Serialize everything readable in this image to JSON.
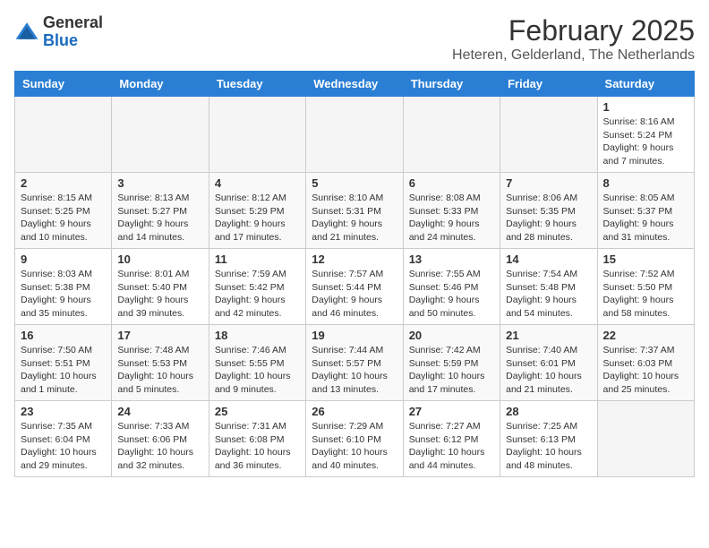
{
  "logo": {
    "text_general": "General",
    "text_blue": "Blue"
  },
  "title": "February 2025",
  "location": "Heteren, Gelderland, The Netherlands",
  "days_of_week": [
    "Sunday",
    "Monday",
    "Tuesday",
    "Wednesday",
    "Thursday",
    "Friday",
    "Saturday"
  ],
  "weeks": [
    [
      {
        "day": "",
        "info": ""
      },
      {
        "day": "",
        "info": ""
      },
      {
        "day": "",
        "info": ""
      },
      {
        "day": "",
        "info": ""
      },
      {
        "day": "",
        "info": ""
      },
      {
        "day": "",
        "info": ""
      },
      {
        "day": "1",
        "info": "Sunrise: 8:16 AM\nSunset: 5:24 PM\nDaylight: 9 hours and 7 minutes."
      }
    ],
    [
      {
        "day": "2",
        "info": "Sunrise: 8:15 AM\nSunset: 5:25 PM\nDaylight: 9 hours and 10 minutes."
      },
      {
        "day": "3",
        "info": "Sunrise: 8:13 AM\nSunset: 5:27 PM\nDaylight: 9 hours and 14 minutes."
      },
      {
        "day": "4",
        "info": "Sunrise: 8:12 AM\nSunset: 5:29 PM\nDaylight: 9 hours and 17 minutes."
      },
      {
        "day": "5",
        "info": "Sunrise: 8:10 AM\nSunset: 5:31 PM\nDaylight: 9 hours and 21 minutes."
      },
      {
        "day": "6",
        "info": "Sunrise: 8:08 AM\nSunset: 5:33 PM\nDaylight: 9 hours and 24 minutes."
      },
      {
        "day": "7",
        "info": "Sunrise: 8:06 AM\nSunset: 5:35 PM\nDaylight: 9 hours and 28 minutes."
      },
      {
        "day": "8",
        "info": "Sunrise: 8:05 AM\nSunset: 5:37 PM\nDaylight: 9 hours and 31 minutes."
      }
    ],
    [
      {
        "day": "9",
        "info": "Sunrise: 8:03 AM\nSunset: 5:38 PM\nDaylight: 9 hours and 35 minutes."
      },
      {
        "day": "10",
        "info": "Sunrise: 8:01 AM\nSunset: 5:40 PM\nDaylight: 9 hours and 39 minutes."
      },
      {
        "day": "11",
        "info": "Sunrise: 7:59 AM\nSunset: 5:42 PM\nDaylight: 9 hours and 42 minutes."
      },
      {
        "day": "12",
        "info": "Sunrise: 7:57 AM\nSunset: 5:44 PM\nDaylight: 9 hours and 46 minutes."
      },
      {
        "day": "13",
        "info": "Sunrise: 7:55 AM\nSunset: 5:46 PM\nDaylight: 9 hours and 50 minutes."
      },
      {
        "day": "14",
        "info": "Sunrise: 7:54 AM\nSunset: 5:48 PM\nDaylight: 9 hours and 54 minutes."
      },
      {
        "day": "15",
        "info": "Sunrise: 7:52 AM\nSunset: 5:50 PM\nDaylight: 9 hours and 58 minutes."
      }
    ],
    [
      {
        "day": "16",
        "info": "Sunrise: 7:50 AM\nSunset: 5:51 PM\nDaylight: 10 hours and 1 minute."
      },
      {
        "day": "17",
        "info": "Sunrise: 7:48 AM\nSunset: 5:53 PM\nDaylight: 10 hours and 5 minutes."
      },
      {
        "day": "18",
        "info": "Sunrise: 7:46 AM\nSunset: 5:55 PM\nDaylight: 10 hours and 9 minutes."
      },
      {
        "day": "19",
        "info": "Sunrise: 7:44 AM\nSunset: 5:57 PM\nDaylight: 10 hours and 13 minutes."
      },
      {
        "day": "20",
        "info": "Sunrise: 7:42 AM\nSunset: 5:59 PM\nDaylight: 10 hours and 17 minutes."
      },
      {
        "day": "21",
        "info": "Sunrise: 7:40 AM\nSunset: 6:01 PM\nDaylight: 10 hours and 21 minutes."
      },
      {
        "day": "22",
        "info": "Sunrise: 7:37 AM\nSunset: 6:03 PM\nDaylight: 10 hours and 25 minutes."
      }
    ],
    [
      {
        "day": "23",
        "info": "Sunrise: 7:35 AM\nSunset: 6:04 PM\nDaylight: 10 hours and 29 minutes."
      },
      {
        "day": "24",
        "info": "Sunrise: 7:33 AM\nSunset: 6:06 PM\nDaylight: 10 hours and 32 minutes."
      },
      {
        "day": "25",
        "info": "Sunrise: 7:31 AM\nSunset: 6:08 PM\nDaylight: 10 hours and 36 minutes."
      },
      {
        "day": "26",
        "info": "Sunrise: 7:29 AM\nSunset: 6:10 PM\nDaylight: 10 hours and 40 minutes."
      },
      {
        "day": "27",
        "info": "Sunrise: 7:27 AM\nSunset: 6:12 PM\nDaylight: 10 hours and 44 minutes."
      },
      {
        "day": "28",
        "info": "Sunrise: 7:25 AM\nSunset: 6:13 PM\nDaylight: 10 hours and 48 minutes."
      },
      {
        "day": "",
        "info": ""
      }
    ]
  ]
}
